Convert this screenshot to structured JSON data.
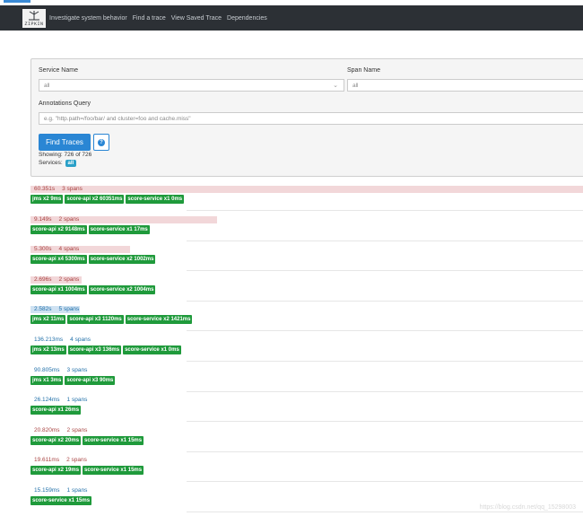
{
  "nav": {
    "brand_text": "ZIPKIN",
    "links": [
      "Investigate system behavior",
      "Find a trace",
      "View Saved Trace",
      "Dependencies"
    ]
  },
  "search": {
    "service_label": "Service Name",
    "service_value": "all",
    "span_label": "Span Name",
    "span_value": "all",
    "annotations_label": "Annotations Query",
    "annotations_placeholder": "e.g. \"http.path=/foo/bar/ and cluster=foo and cache.miss\"",
    "find_button": "Find Traces",
    "help_icon": "?",
    "showing": "Showing: 726 of 726",
    "services_label": "Services:",
    "services_badge": "all"
  },
  "colors": {
    "red_text": "#a94442",
    "blue_text": "#1f6fa8",
    "red_bar": "#f2d7d9",
    "blue_bar": "#cfe2f2",
    "tag_green": "#1f9a3b"
  },
  "traces": [
    {
      "duration": "60.351s",
      "spans": "3 spans",
      "tone": "red",
      "fill": 1.0,
      "tags": [
        "jms x2 9ms",
        "score-api x2 60351ms",
        "score-service x1 0ms"
      ]
    },
    {
      "duration": "9.149s",
      "spans": "2 spans",
      "tone": "red",
      "fill": 0.338,
      "tags": [
        "score-api x2 9148ms",
        "score-service x1 17ms"
      ]
    },
    {
      "duration": "5.300s",
      "spans": "4 spans",
      "tone": "red",
      "fill": 0.18,
      "tags": [
        "score-api x4 5300ms",
        "score-service x2 1002ms"
      ]
    },
    {
      "duration": "2.696s",
      "spans": "2 spans",
      "tone": "red",
      "fill": 0.092,
      "tags": [
        "score-api x1 1004ms",
        "score-service x2 1004ms"
      ]
    },
    {
      "duration": "2.582s",
      "spans": "5 spans",
      "tone": "blue",
      "fill": 0.09,
      "tags": [
        "jms x2 11ms",
        "score-api x3 1120ms",
        "score-service x2 1421ms"
      ]
    },
    {
      "duration": "136.213ms",
      "spans": "4 spans",
      "tone": "blue",
      "fill": 0,
      "tags": [
        "jms x2 13ms",
        "score-api x3 136ms",
        "score-service x1 0ms"
      ]
    },
    {
      "duration": "90.805ms",
      "spans": "3 spans",
      "tone": "blue",
      "fill": 0,
      "tags": [
        "jms x1 3ms",
        "score-api x3 90ms"
      ]
    },
    {
      "duration": "26.124ms",
      "spans": "1 spans",
      "tone": "blue",
      "fill": 0,
      "tags": [
        "score-api x1 26ms"
      ]
    },
    {
      "duration": "20.820ms",
      "spans": "2 spans",
      "tone": "red",
      "fill": 0,
      "tags": [
        "score-api x2 20ms",
        "score-service x1 15ms"
      ]
    },
    {
      "duration": "19.611ms",
      "spans": "2 spans",
      "tone": "red",
      "fill": 0,
      "tags": [
        "score-api x2 19ms",
        "score-service x1 15ms"
      ]
    },
    {
      "duration": "15.159ms",
      "spans": "1 spans",
      "tone": "blue",
      "fill": 0,
      "tags": [
        "score-service x1 15ms"
      ]
    }
  ],
  "watermark": "https://blog.csdn.net/qq_15298003"
}
